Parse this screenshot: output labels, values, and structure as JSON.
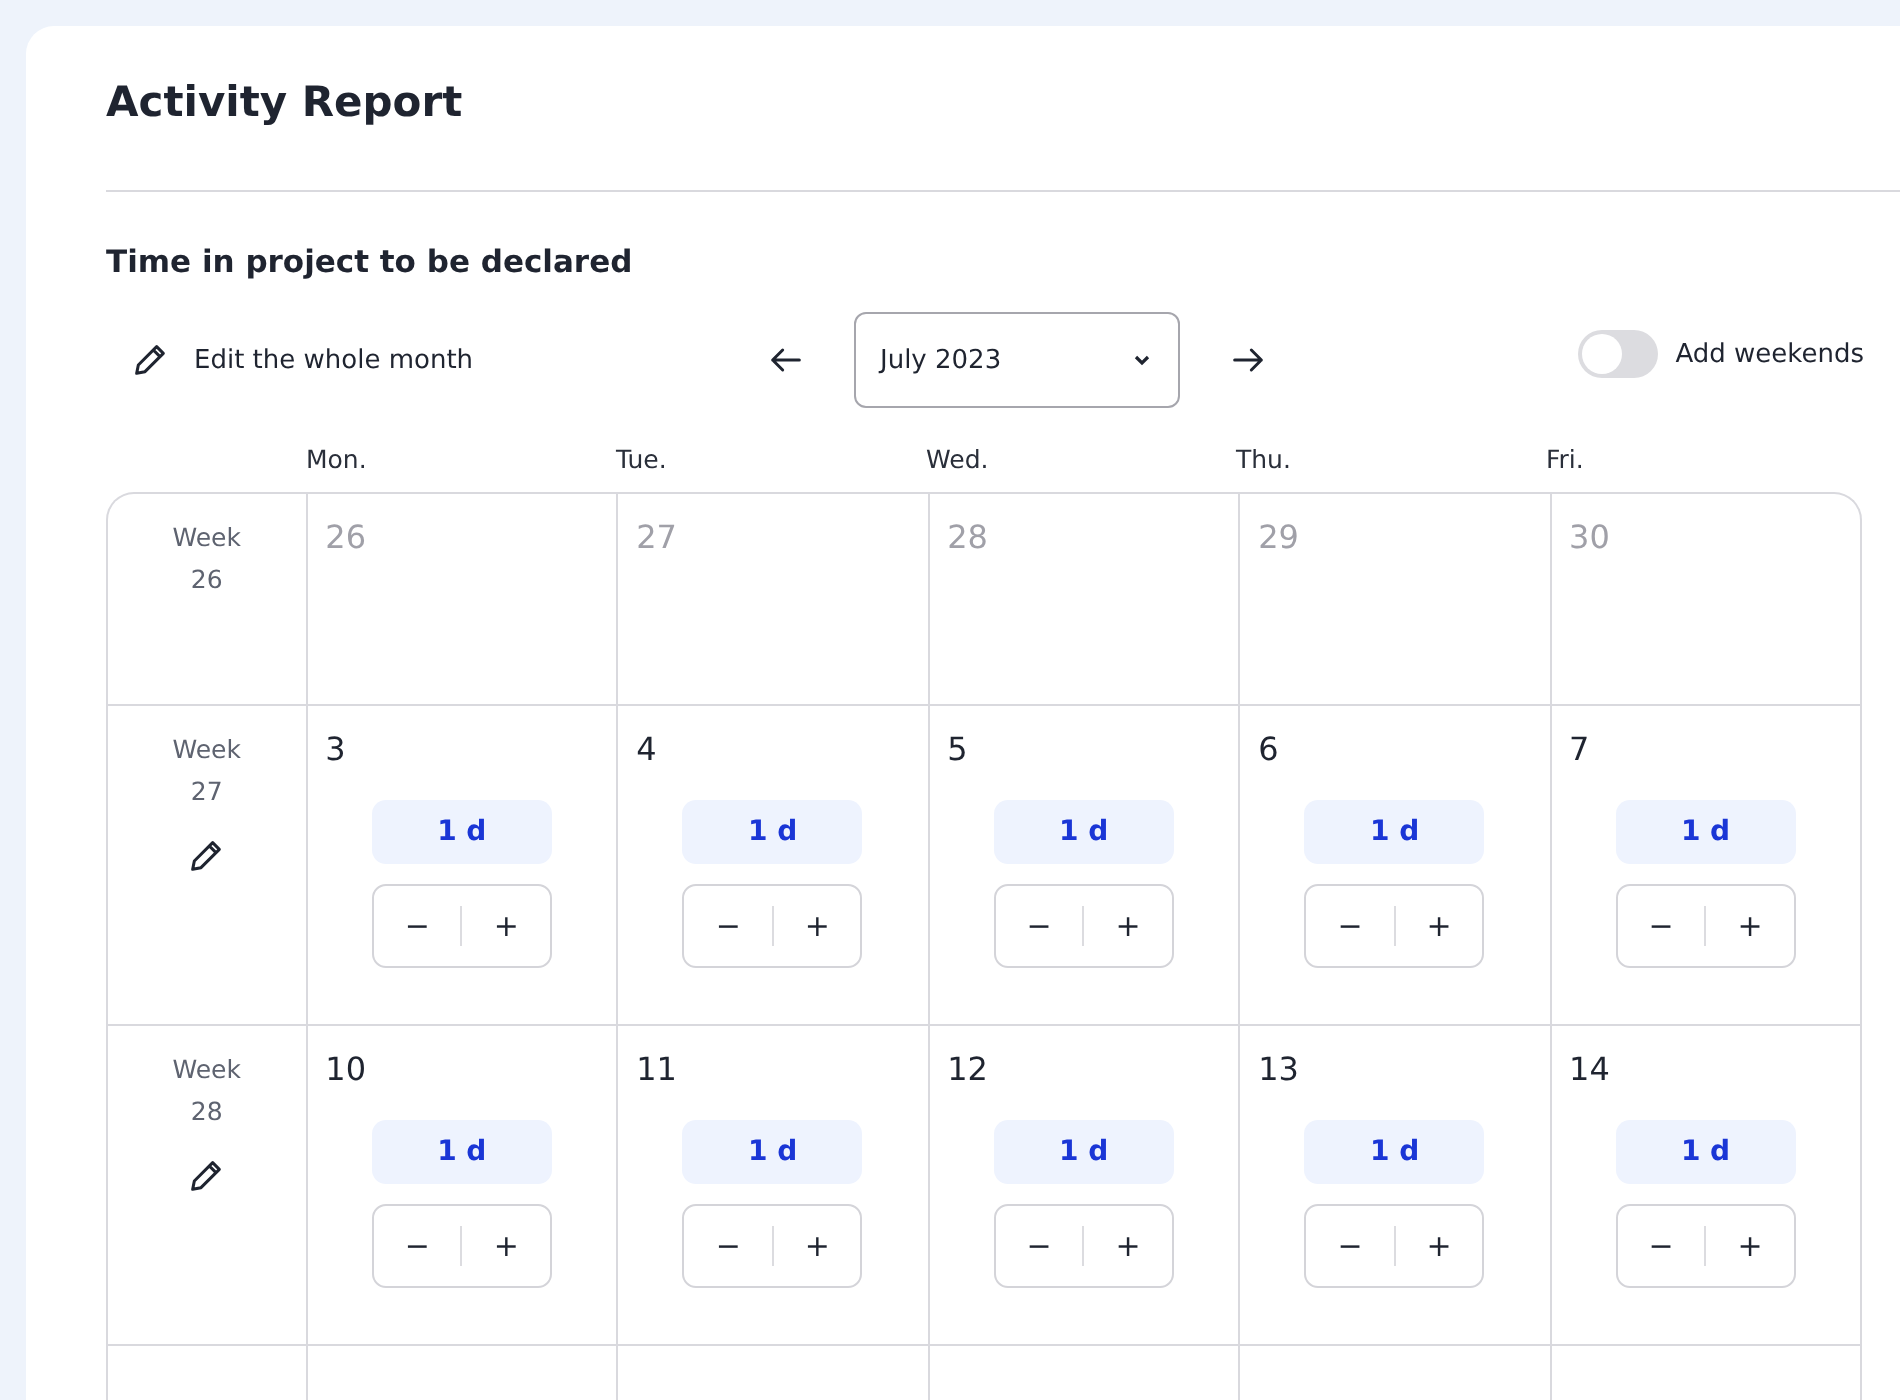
{
  "title": "Activity Report",
  "section_title": "Time in project to be declared",
  "toolbar": {
    "edit_month": "Edit the whole month",
    "month": "July 2023",
    "add_weekends": {
      "label": "Add weekends",
      "on": false
    }
  },
  "weekdays": [
    "Mon.",
    "Tue.",
    "Wed.",
    "Thu.",
    "Fri."
  ],
  "weeks": [
    {
      "label": "Week 26",
      "editable": false,
      "days": [
        {
          "date": "26",
          "in_month": false
        },
        {
          "date": "27",
          "in_month": false
        },
        {
          "date": "28",
          "in_month": false
        },
        {
          "date": "29",
          "in_month": false
        },
        {
          "date": "30",
          "in_month": false
        }
      ]
    },
    {
      "label": "Week 27",
      "editable": true,
      "days": [
        {
          "date": "3",
          "in_month": true,
          "value": "1 d",
          "minus": "−",
          "plus": "+"
        },
        {
          "date": "4",
          "in_month": true,
          "value": "1 d",
          "minus": "−",
          "plus": "+"
        },
        {
          "date": "5",
          "in_month": true,
          "value": "1 d",
          "minus": "−",
          "plus": "+"
        },
        {
          "date": "6",
          "in_month": true,
          "value": "1 d",
          "minus": "−",
          "plus": "+"
        },
        {
          "date": "7",
          "in_month": true,
          "value": "1 d",
          "minus": "−",
          "plus": "+"
        }
      ]
    },
    {
      "label": "Week 28",
      "editable": true,
      "days": [
        {
          "date": "10",
          "in_month": true,
          "value": "1 d",
          "minus": "−",
          "plus": "+"
        },
        {
          "date": "11",
          "in_month": true,
          "value": "1 d",
          "minus": "−",
          "plus": "+"
        },
        {
          "date": "12",
          "in_month": true,
          "value": "1 d",
          "minus": "−",
          "plus": "+"
        },
        {
          "date": "13",
          "in_month": true,
          "value": "1 d",
          "minus": "−",
          "plus": "+"
        },
        {
          "date": "14",
          "in_month": true,
          "value": "1 d",
          "minus": "−",
          "plus": "+"
        }
      ]
    }
  ]
}
